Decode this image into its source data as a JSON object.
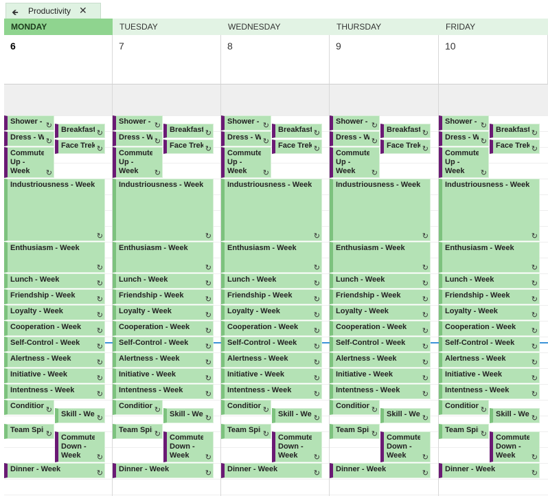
{
  "tab": {
    "back_icon": "back-arrow-icon",
    "title": "Productivity",
    "close_icon": "close-icon"
  },
  "days": [
    {
      "name": "MONDAY",
      "date": "6",
      "today": true
    },
    {
      "name": "TUESDAY",
      "date": "7",
      "today": false
    },
    {
      "name": "WEDNESDAY",
      "date": "8",
      "today": false
    },
    {
      "name": "THURSDAY",
      "date": "9",
      "today": false
    },
    {
      "name": "FRIDAY",
      "date": "10",
      "today": false
    }
  ],
  "events": [
    {
      "label": "Shower - Week",
      "bar": "purple"
    },
    {
      "label": "Breakfast - Week",
      "bar": "purple"
    },
    {
      "label": "Dress - Week",
      "bar": "purple"
    },
    {
      "label": "Face Trek - Week",
      "bar": "purple"
    },
    {
      "label": "Commute Up - Week",
      "bar": "purple"
    },
    {
      "label": "Industriousness - Week",
      "bar": "green"
    },
    {
      "label": "Enthusiasm - Week",
      "bar": "green"
    },
    {
      "label": "Lunch - Week",
      "bar": "green"
    },
    {
      "label": "Friendship - Week",
      "bar": "green"
    },
    {
      "label": "Loyalty - Week",
      "bar": "green"
    },
    {
      "label": "Cooperation - Week",
      "bar": "green"
    },
    {
      "label": "Self-Control - Week",
      "bar": "green"
    },
    {
      "label": "Alertness - Week",
      "bar": "green"
    },
    {
      "label": "Initiative - Week",
      "bar": "green"
    },
    {
      "label": "Intentness - Week",
      "bar": "green"
    },
    {
      "label": "Condition - Week",
      "bar": "green"
    },
    {
      "label": "Skill - Week",
      "bar": "green"
    },
    {
      "label": "Team Spirit - Week",
      "bar": "green"
    },
    {
      "label": "Commute Down - Week",
      "bar": "purple"
    },
    {
      "label": "Dinner - Week",
      "bar": "purple"
    }
  ],
  "recurring_icon": "recurring-icon",
  "colors": {
    "event_bg": "#b4e2b5",
    "today_header": "#8fd48f",
    "purple_bar": "#6a1a74",
    "now_line": "#3b93d8"
  }
}
